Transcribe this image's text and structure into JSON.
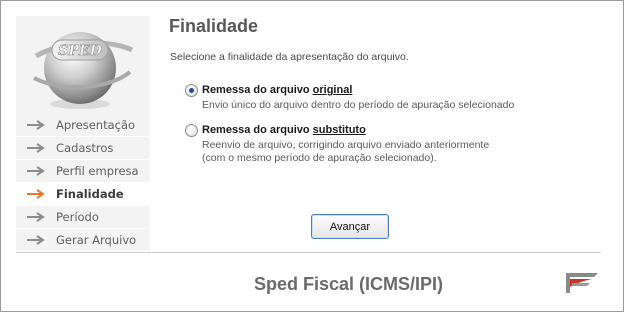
{
  "window": {
    "title": "Finalidade",
    "subtitle": "Selecione a finalidade da apresentação do arquivo."
  },
  "logo": {
    "text": "SPED",
    "icon": "sped-globe-logo"
  },
  "sidebar": {
    "items": [
      {
        "label": "Apresentação",
        "active": false
      },
      {
        "label": "Cadastros",
        "active": false
      },
      {
        "label": "Perfil empresa",
        "active": false
      },
      {
        "label": "Finalidade",
        "active": true
      },
      {
        "label": "Período",
        "active": false
      },
      {
        "label": "Gerar Arquivo",
        "active": false
      }
    ]
  },
  "options": [
    {
      "label_pre": "Remessa do arquivo ",
      "label_underlined": "original",
      "description_lines": [
        "Envio único do arquivo dentro do período de apuração selecionado"
      ],
      "selected": true
    },
    {
      "label_pre": "Remessa do arquivo ",
      "label_underlined": "substituto",
      "description_lines": [
        "Reenvio de arquivo, corrigindo arquivo enviado anteriormente",
        "(com o mesmo período de apuração selecionado)."
      ],
      "selected": false
    }
  ],
  "actions": {
    "next_label": "Avançar"
  },
  "footer": {
    "title": "Sped Fiscal (ICMS/IPI)",
    "brand_icon": "receita-federal-logo"
  },
  "colors": {
    "arrow_inactive": "#8c8c8c",
    "arrow_active": "#e8772a",
    "button_border": "#4b7fb6",
    "radio_dot": "#1f4f94"
  }
}
